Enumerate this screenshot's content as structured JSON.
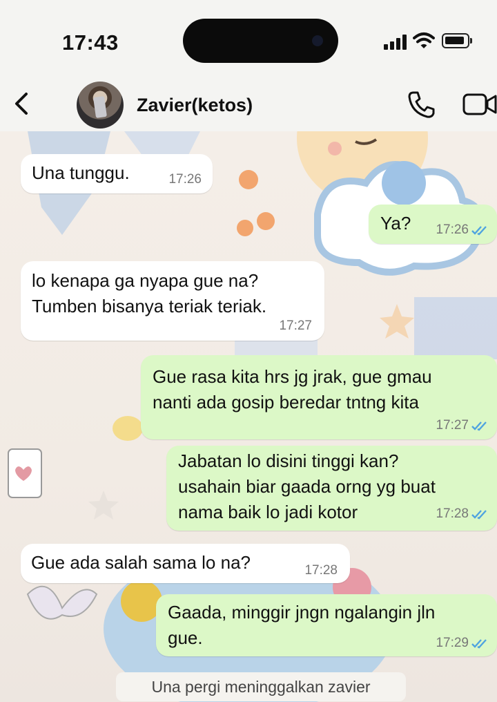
{
  "status_bar": {
    "time": "17:43",
    "icons": [
      "signal-icon",
      "wifi-icon",
      "battery-icon"
    ]
  },
  "header": {
    "contact_name": "Zavier(ketos)",
    "icons": [
      "back-chevron-icon",
      "avatar",
      "phone-icon",
      "video-camera-icon"
    ]
  },
  "colors": {
    "incoming_bubble": "#ffffff",
    "outgoing_bubble": "#dcf8c7",
    "read_ticks": "#4fa3e0"
  },
  "messages": [
    {
      "direction": "in",
      "text": "Una tunggu.",
      "time": "17:26"
    },
    {
      "direction": "out",
      "text": "Ya?",
      "time": "17:26",
      "read": true
    },
    {
      "direction": "in",
      "text": "lo kenapa ga nyapa gue na?\nTumben bisanya teriak teriak.",
      "time": "17:27"
    },
    {
      "direction": "out",
      "text": "Gue rasa kita hrs jg jrak, gue gmau\nnanti ada gosip beredar tntng kita",
      "time": "17:27",
      "read": true
    },
    {
      "direction": "out",
      "text": "Jabatan lo disini tinggi kan?\nusahain biar gaada orng yg buat\nnama baik lo jadi kotor",
      "time": "17:28",
      "read": true
    },
    {
      "direction": "in",
      "text": "Gue ada salah sama lo na?",
      "time": "17:28"
    },
    {
      "direction": "out",
      "text": "Gaada, minggir jngn ngalangin jln\ngue.",
      "time": "17:29",
      "read": true
    }
  ],
  "system_notice": "Una pergi meninggalkan zavier"
}
